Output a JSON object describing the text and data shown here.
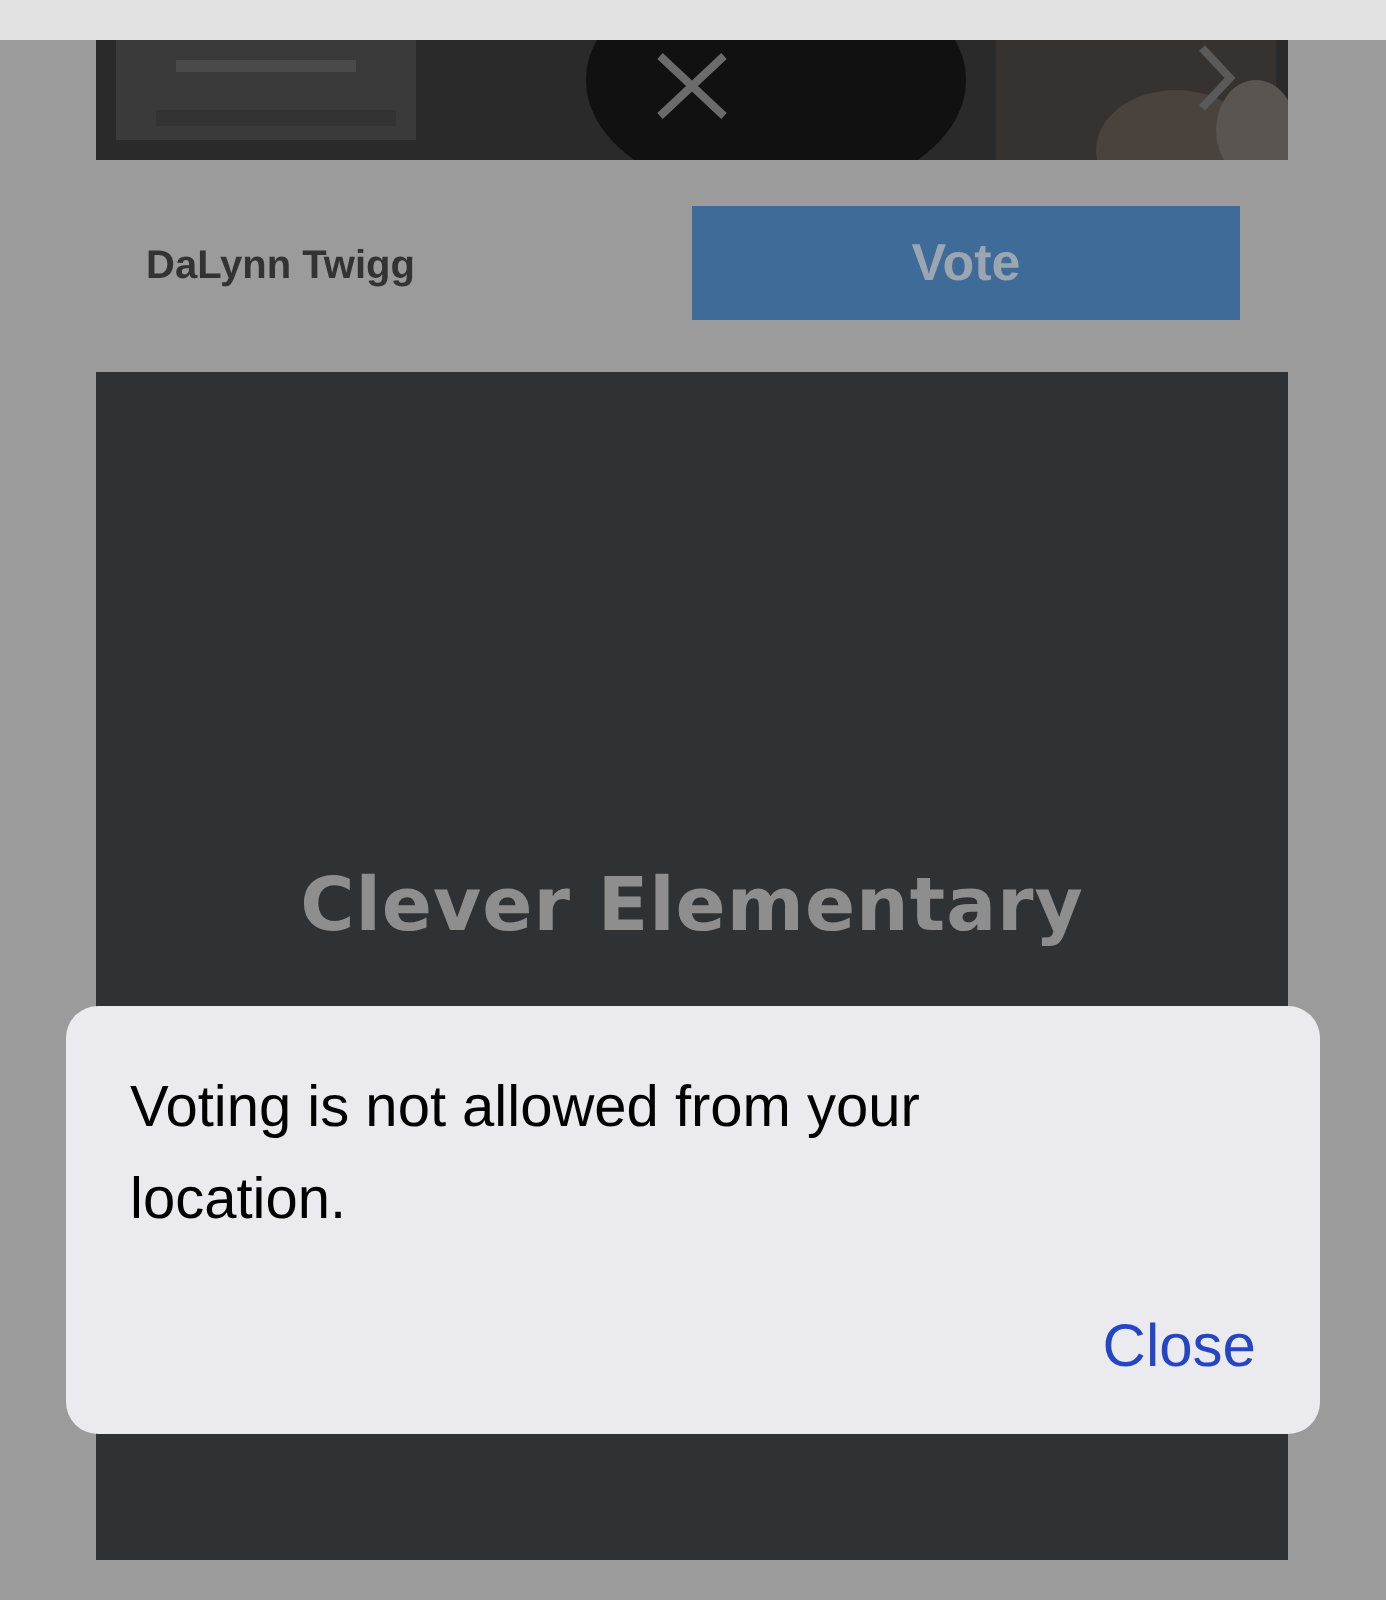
{
  "candidate": {
    "name": "DaLynn Twigg",
    "vote_button": "Vote"
  },
  "school_card": {
    "title": "Clever Elementary"
  },
  "alert": {
    "message": "Voting is not allowed from your location.",
    "button": "Close"
  }
}
